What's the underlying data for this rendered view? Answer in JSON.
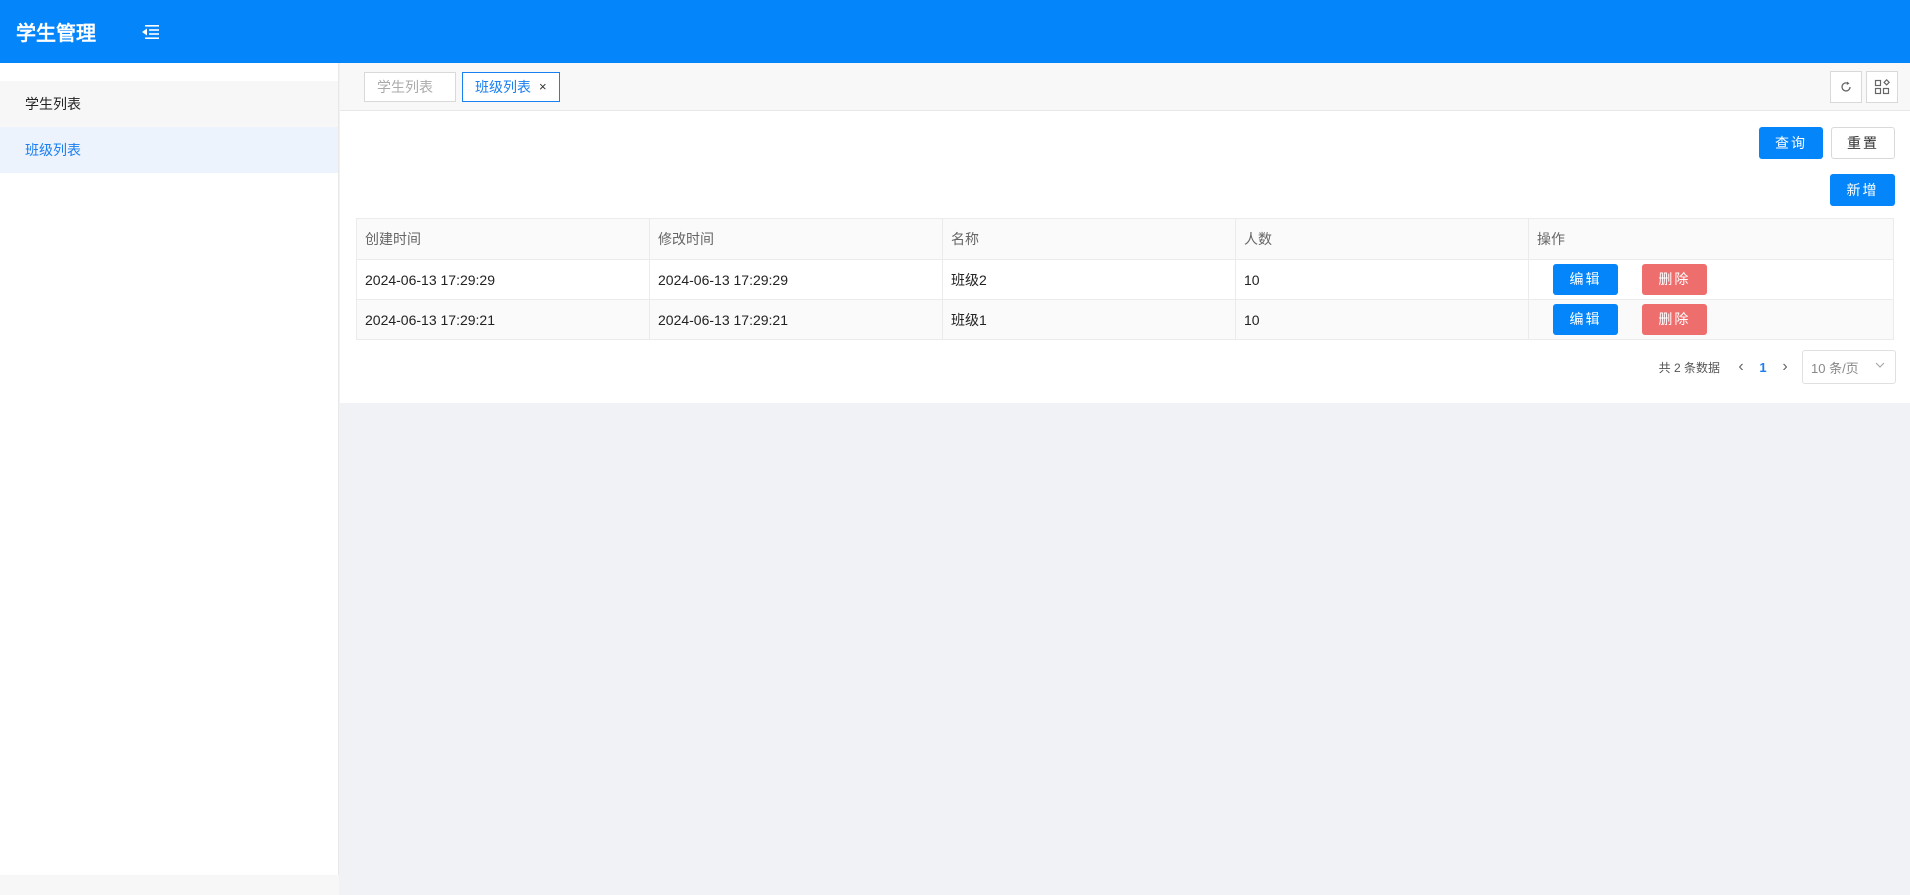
{
  "app": {
    "title": "学生管理"
  },
  "sidebar": {
    "items": [
      {
        "label": "学生列表"
      },
      {
        "label": "班级列表"
      }
    ]
  },
  "tabs": [
    {
      "label": "学生列表"
    },
    {
      "label": "班级列表",
      "close": "×"
    }
  ],
  "toolbar": {
    "query_label": "查询",
    "reset_label": "重置",
    "add_label": "新增"
  },
  "table": {
    "columns": [
      "创建时间",
      "修改时间",
      "名称",
      "人数",
      "操作"
    ],
    "rows": [
      {
        "created": "2024-06-13 17:29:29",
        "modified": "2024-06-13 17:29:29",
        "name": "班级2",
        "count": "10",
        "edit": "编辑",
        "delete": "删除"
      },
      {
        "created": "2024-06-13 17:29:21",
        "modified": "2024-06-13 17:29:21",
        "name": "班级1",
        "count": "10",
        "edit": "编辑",
        "delete": "删除"
      }
    ]
  },
  "pagination": {
    "total_text": "共 2 条数据",
    "current_page": "1",
    "page_size": "10 条/页"
  },
  "colors": {
    "primary": "#0585fa",
    "danger": "#ee6e6e",
    "active_text": "#1a7ff0"
  }
}
